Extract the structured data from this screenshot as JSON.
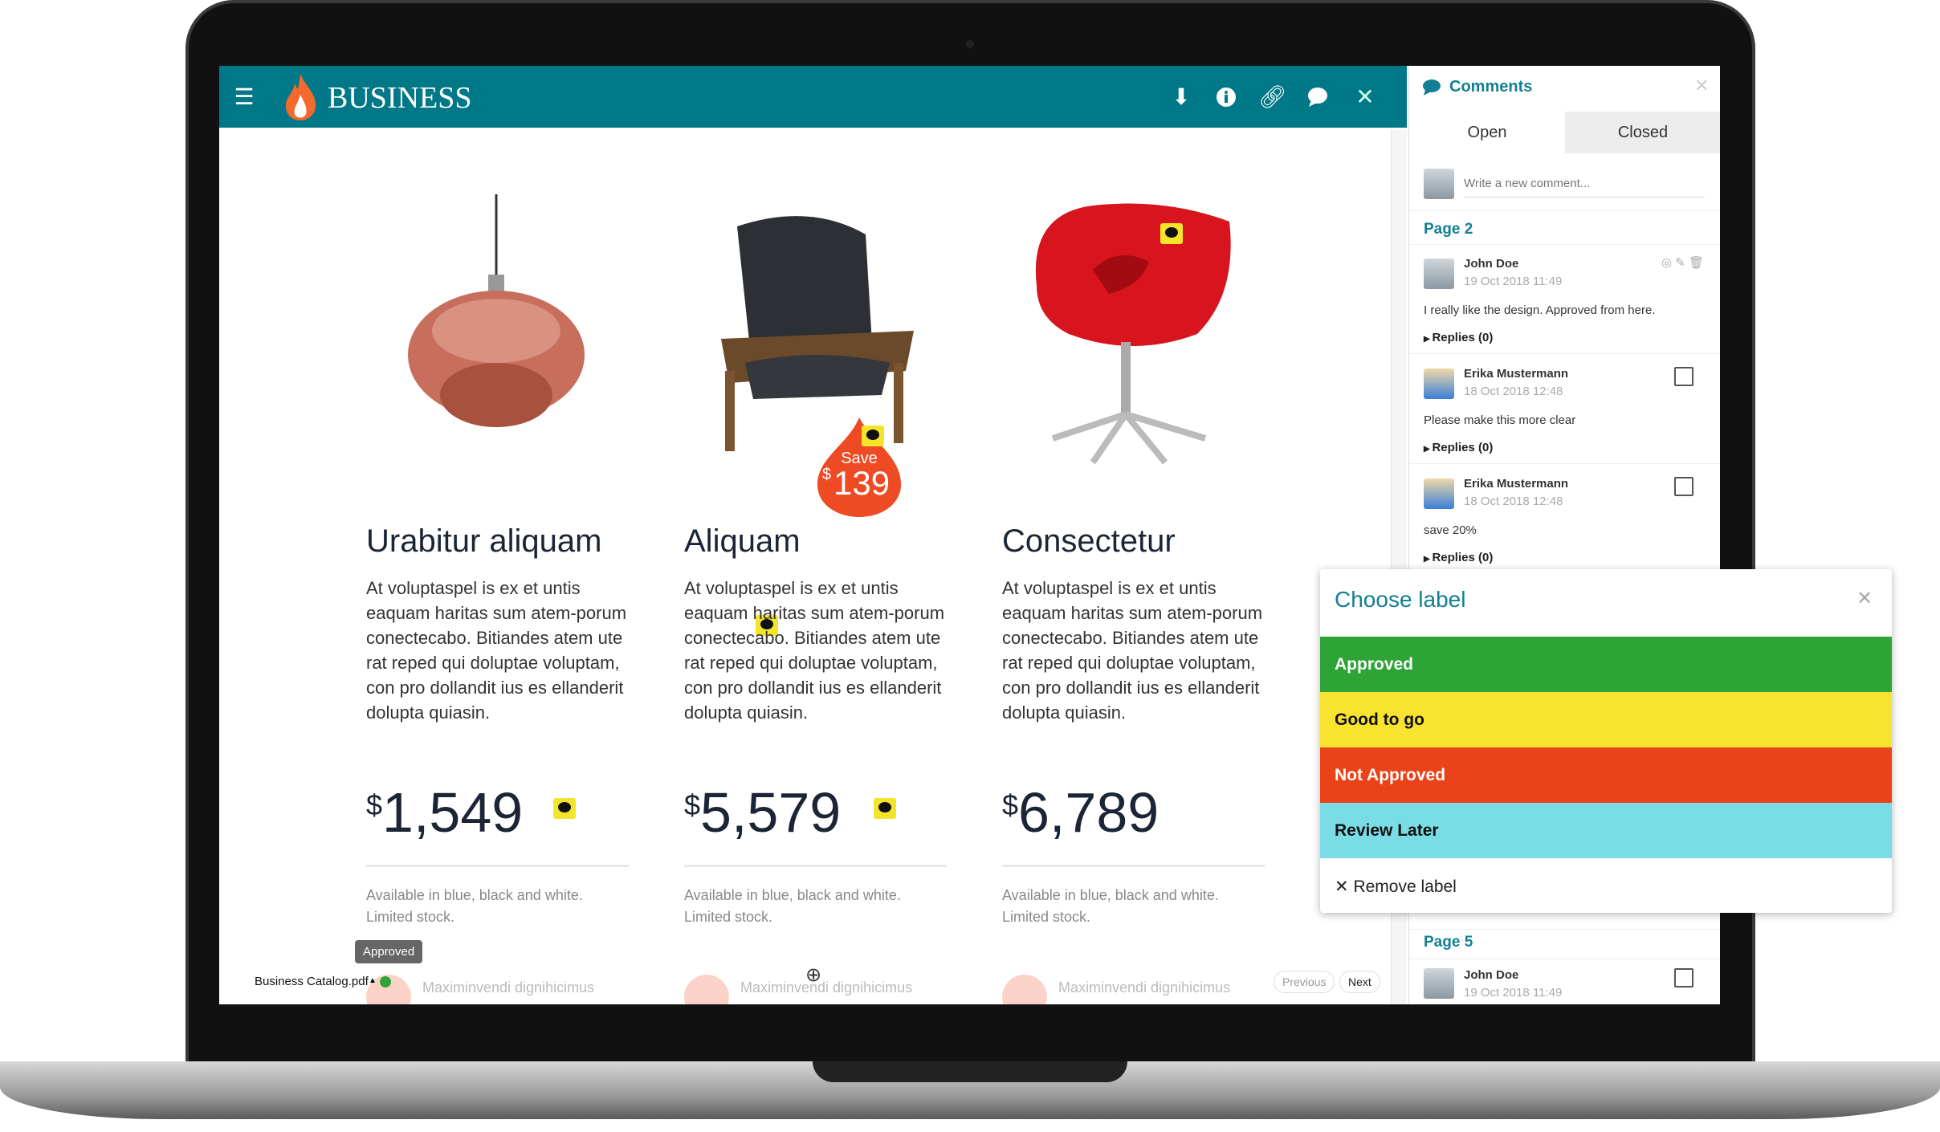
{
  "app": {
    "brand": "BUSINESS",
    "icons": [
      "menu-icon",
      "flame-logo-icon",
      "download-icon",
      "info-icon",
      "link-icon",
      "comment-icon",
      "close-icon"
    ]
  },
  "products": [
    {
      "title": "Urabitur aliquam",
      "body": "At voluptaspel is ex et untis eaquam haritas sum atem-porum conectecabo. Bitiandes atem ute rat reped qui doluptae voluptam, con pro dollandit ius es ellanderit dolupta quiasin.",
      "price": "1,549",
      "currency": "$",
      "avail1": "Available in blue, black and white.",
      "avail2": "Limited stock.",
      "teaser": "Maximinvendi dignihicimus"
    },
    {
      "title": "Aliquam",
      "body": "At voluptaspel is ex et untis eaquam haritas sum atem-porum conectecabo. Bitiandes atem ute rat reped qui doluptae voluptam, con pro dollandit ius es ellanderit dolupta quiasin.",
      "price": "5,579",
      "currency": "$",
      "avail1": "Available in blue, black and white.",
      "avail2": "Limited stock.",
      "teaser": "Maximinvendi dignihicimus"
    },
    {
      "title": "Consectetur",
      "body": "At voluptaspel is ex et untis eaquam haritas sum atem-porum conectecabo. Bitiandes atem ute rat reped qui doluptae voluptam, con pro dollandit ius es ellanderit dolupta quiasin.",
      "price": "6,789",
      "currency": "$",
      "avail1": "Available in blue, black and white.",
      "avail2": "Limited stock.",
      "teaser": "Maximinvendi dignihicimus"
    }
  ],
  "badge": {
    "line1": "Save",
    "currency": "$",
    "amount": "139"
  },
  "footer": {
    "filename": "Business Catalog.pdf",
    "status_tooltip": "Approved",
    "status_color": "#2ea336",
    "previous": "Previous",
    "next": "Next"
  },
  "comments": {
    "title": "Comments",
    "tabs": [
      "Open",
      "Closed"
    ],
    "input_placeholder": "Write a new comment...",
    "page2": "Page 2",
    "page5": "Page 5",
    "items": [
      {
        "author": "John Doe",
        "date": "19 Oct 2018 11:49",
        "text": "I really like the design. Approved from here.",
        "replies": "Replies (0)"
      },
      {
        "author": "Erika Mustermann",
        "date": "18 Oct 2018 12:48",
        "text": "Please make this more clear",
        "replies": "Replies (0)"
      },
      {
        "author": "Erika Mustermann",
        "date": "18 Oct 2018 12:48",
        "text": "save 20%",
        "replies": "Replies (0)"
      },
      {
        "author": "John Doe",
        "date": "19 Oct 2018 11:49"
      }
    ]
  },
  "label_popup": {
    "title": "Choose label",
    "labels": [
      {
        "name": "Approved",
        "color": "#2ea336"
      },
      {
        "name": "Good to go",
        "color": "#f9e331"
      },
      {
        "name": "Not Approved",
        "color": "#ea4219"
      },
      {
        "name": "Review Later",
        "color": "#7adde6"
      }
    ],
    "remove": "Remove label"
  }
}
